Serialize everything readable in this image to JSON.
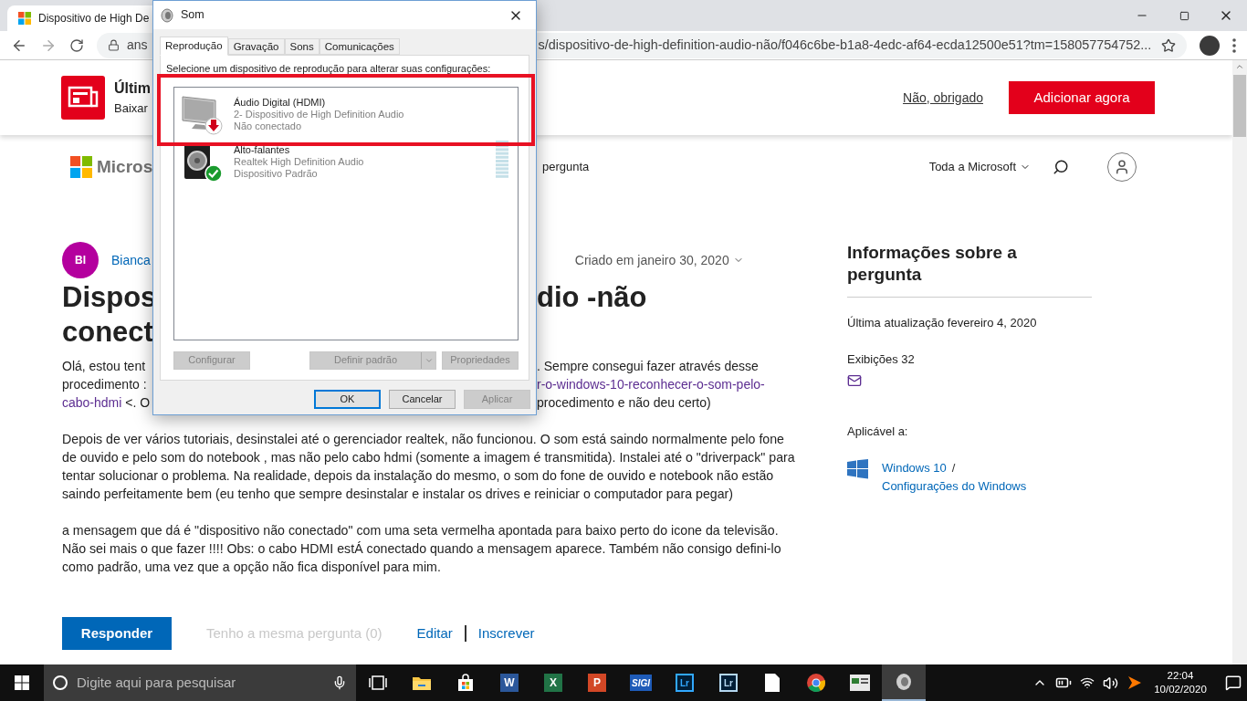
{
  "browser": {
    "tab": {
      "title": "Dispositivo de High De"
    },
    "address": {
      "left": "ans",
      "right": "s/dispositivo-de-high-definition-audio-não/f046c6be-b1a8-4edc-af64-ecda12500e51?tm=158057754752..."
    }
  },
  "banner": {
    "title": "Últim",
    "subtitle": "Baixar",
    "decline": "Não, obrigado",
    "accept": "Adicionar agora"
  },
  "nav": {
    "brand": "Micros",
    "link_fragment": "pergunta",
    "menu": "Toda a Microsoft"
  },
  "question": {
    "avatar": "BI",
    "author": "Bianca",
    "created": "Criado em janeiro 30, 2020",
    "title_lines": [
      {
        "left": "Dispos",
        "right": "dio -não"
      },
      {
        "left": "conect"
      }
    ],
    "intro_lines": [
      {
        "left": [
          {
            "text": "Olá, estou tent",
            "link": false
          }
        ],
        "right": [
          {
            "text": ". Sempre consegui fazer através desse",
            "link": false
          }
        ]
      },
      {
        "left": [
          {
            "text": "procedimento :",
            "link": false
          }
        ],
        "right": [
          {
            "text": "r-o-windows-10-reconhecer-o-som-pelo-",
            "link": true
          }
        ]
      },
      {
        "left": [
          {
            "text": "cabo-hdmi",
            "link": true
          },
          {
            "text": " <. O",
            "link": false
          }
        ],
        "right": [
          {
            "text": "procedimento e não deu certo)",
            "link": false
          }
        ]
      }
    ],
    "paragraphs": [
      "Depois de ver vários tutoriais, desinstalei até o gerenciador realtek, não funcionou. O som está saindo normalmente pelo fone de ouvido e pelo som do notebook , mas não pelo cabo hdmi (somente a imagem é transmitida). Instalei até o \"driverpack\" para tentar solucionar o problema. Na realidade, depois da instalação do mesmo, o som do fone de ouvido e notebook não estão saindo perfeitamente bem (eu tenho que sempre desinstalar e instalar os drives e reiniciar o computador para pegar)",
      "a mensagem que dá é \"dispositivo não conectado\" com uma seta vermelha apontada para baixo perto do icone da televisão. Não sei mais o que fazer !!!! Obs: o cabo HDMI estÁ   conectado quando a mensagem aparece.  Também não consigo defini-lo como padrão, uma vez que a opção não fica disponível para mim."
    ],
    "actions": [
      {
        "label": "Responder",
        "kind": "primary",
        "disabled": false
      },
      {
        "label": "Tenho a mesma pergunta (0)",
        "kind": "text",
        "disabled": true
      },
      {
        "label": "Editar",
        "kind": "link",
        "disabled": false
      },
      {
        "label": "Inscrever",
        "kind": "link",
        "disabled": false
      }
    ]
  },
  "sidebar": {
    "title": "Informações sobre a pergunta",
    "updated": "Última atualização fevereiro 4, 2020",
    "views": "Exibições 32",
    "applies_label": "Aplicável a:",
    "products": [
      {
        "label": "Windows 10"
      },
      {
        "label": "Configurações do Windows"
      }
    ],
    "separator": "/"
  },
  "dialog": {
    "title": "Som",
    "tabs": [
      {
        "label": "Reprodução",
        "selected": true
      },
      {
        "label": "Gravação",
        "selected": false
      },
      {
        "label": "Sons",
        "selected": false
      },
      {
        "label": "Comunicações",
        "selected": false
      }
    ],
    "instruction": "Selecione um dispositivo de reprodução para alterar suas configurações:",
    "devices": [
      {
        "kind": "monitor",
        "name": "Áudio Digital (HDMI)",
        "driver": "2- Dispositivo de High Definition Audio",
        "status": "Não conectado",
        "connected": false
      },
      {
        "kind": "speaker",
        "name": "Alto-falantes",
        "driver": "Realtek High Definition Audio",
        "status": "Dispositivo Padrão",
        "connected": true
      }
    ],
    "buttons": [
      {
        "label": "Configurar",
        "disabled": true,
        "split": false
      },
      {
        "label": "Definir padrão",
        "disabled": true,
        "split": true
      },
      {
        "label": "Propriedades",
        "disabled": true,
        "split": false
      }
    ],
    "footer": [
      {
        "label": "OK",
        "disabled": false,
        "focused": true
      },
      {
        "label": "Cancelar",
        "disabled": false,
        "focused": false
      },
      {
        "label": "Aplicar",
        "disabled": true,
        "focused": false
      }
    ]
  },
  "taskbar": {
    "search_placeholder": "Digite aqui para pesquisar",
    "apps": [
      {
        "kind": "taskview",
        "active": false
      },
      {
        "kind": "folder",
        "active": false
      },
      {
        "kind": "store",
        "active": false
      },
      {
        "kind": "office",
        "label": "W",
        "color": "#2b579a",
        "active": false
      },
      {
        "kind": "office",
        "label": "X",
        "color": "#217346",
        "active": false
      },
      {
        "kind": "office",
        "label": "P",
        "color": "#d24726",
        "active": false
      },
      {
        "kind": "badge",
        "label": "SIGI",
        "color": "#1e5bb8",
        "active": false
      },
      {
        "kind": "lr",
        "label": "Lr",
        "color": "#31a8ff",
        "active": false
      },
      {
        "kind": "lr",
        "label": "Lr",
        "color": "#b4d7f0",
        "active": false
      },
      {
        "kind": "file",
        "active": false
      },
      {
        "kind": "chrome",
        "active": false
      },
      {
        "kind": "window",
        "active": false
      },
      {
        "kind": "sound",
        "active": true
      }
    ],
    "time": "22:04",
    "date": "10/02/2020"
  }
}
